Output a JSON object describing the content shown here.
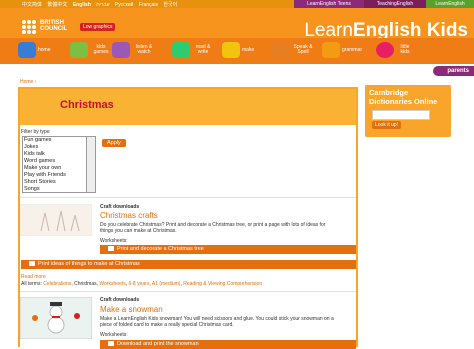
{
  "language_bar": {
    "languages": [
      "中文简体",
      "繁體中文",
      "English",
      "עברית",
      "Русский",
      "Français",
      "한국어"
    ],
    "active": "English"
  },
  "site_links": [
    "LearnEnglish Teens",
    "TeachingEnglish",
    "LearnEnglish"
  ],
  "header": {
    "logo_line1": "BRITISH",
    "logo_line2": "COUNCIL",
    "low_graphics_label": "Low graphics",
    "brand_prefix": "Learn",
    "brand_suffix": "English Kids"
  },
  "nav": [
    {
      "label": "home",
      "icon": "house-icon",
      "color": "#3a7bd5"
    },
    {
      "label": "kids games",
      "icon": "gamepad-icon",
      "color": "#7bc043"
    },
    {
      "label": "listen & watch",
      "icon": "headphones-icon",
      "color": "#9b59b6"
    },
    {
      "label": "read & write",
      "icon": "pencil-icon",
      "color": "#2ecc71"
    },
    {
      "label": "make",
      "icon": "scissors-icon",
      "color": "#f1c40f"
    },
    {
      "label": "Speak & Spell",
      "icon": "speech-icon",
      "color": "#e67e22"
    },
    {
      "label": "grammar",
      "icon": "crown-icon",
      "color": "#f39c12"
    },
    {
      "label": "little kids",
      "icon": "child-icon",
      "color": "#e91e63"
    }
  ],
  "parents_label": "parents",
  "breadcrumb": "Home ›",
  "page_title": "Christmas",
  "filter": {
    "label": "Filter by type",
    "options": [
      "Fun games",
      "Jokes",
      "Kids talk",
      "Word games",
      "Make your own",
      "Play with Friends",
      "Short Stories",
      "Songs"
    ],
    "apply_label": "Apply"
  },
  "items": [
    {
      "type": "Craft downloads",
      "title": "Christmas crafts",
      "description": "Do you celebrate Christmas? Print and decorate a Christmas tree, or print a page with lots of ideas for things you can make at Christmas.",
      "worksheets_label": "Worksheets:",
      "download1": "Print and decorate a Christmas tree",
      "download2": "Print ideas of things to make at Christmas",
      "read_more": "Read more",
      "terms_label": "All terms:",
      "terms": [
        {
          "text": "Celebrations",
          "link": true
        },
        {
          "text": "Christmas",
          "link": false
        },
        {
          "text": "Worksheets",
          "link": true
        },
        {
          "text": "6-8 years",
          "link": true
        },
        {
          "text": "A1 (medium)",
          "link": true
        },
        {
          "text": "Reading & Viewing Comprehension",
          "link": true
        }
      ]
    },
    {
      "type": "Craft downloads",
      "title": "Make a snowman",
      "description": "Make a LearnEnglish Kids snowman! You will need scissors and glue. You could stick your snowman on a piece of folded card to make a really special Christmas card.",
      "worksheets_label": "Worksheets:",
      "download1": "Download and print the snowman"
    }
  ],
  "sidebar": {
    "title": "Cambridge Dictionaries Online",
    "input_placeholder": "",
    "button_label": "Look it up!"
  }
}
